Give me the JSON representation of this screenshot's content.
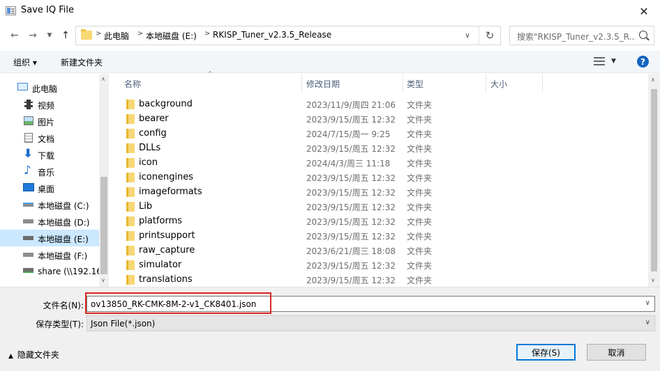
{
  "window": {
    "title": "Save IQ File"
  },
  "address": {
    "crumbs": [
      "此电脑",
      "本地磁盘 (E:)",
      "RKISP_Tuner_v2.3.5_Release"
    ],
    "separator": ">",
    "search_placeholder": "搜索\"RKISP_Tuner_v2.3.5_R..."
  },
  "toolbar": {
    "organize": "组织 ▾",
    "new_folder": "新建文件夹"
  },
  "nav": {
    "items": [
      {
        "label": "此电脑",
        "icon": "computer-icon",
        "selected": false
      },
      {
        "label": "视频",
        "icon": "video-icon",
        "selected": false
      },
      {
        "label": "图片",
        "icon": "pictures-icon",
        "selected": false
      },
      {
        "label": "文档",
        "icon": "documents-icon",
        "selected": false
      },
      {
        "label": "下载",
        "icon": "download-icon",
        "selected": false
      },
      {
        "label": "音乐",
        "icon": "music-icon",
        "selected": false
      },
      {
        "label": "桌面",
        "icon": "desktop-icon",
        "selected": false
      },
      {
        "label": "本地磁盘 (C:)",
        "icon": "drive-icon",
        "selected": false
      },
      {
        "label": "本地磁盘 (D:)",
        "icon": "drive-icon",
        "selected": false
      },
      {
        "label": "本地磁盘 (E:)",
        "icon": "drive-icon",
        "selected": true
      },
      {
        "label": "本地磁盘 (F:)",
        "icon": "drive-icon",
        "selected": false
      },
      {
        "label": "share (\\\\192.16",
        "icon": "network-drive-icon",
        "selected": false
      }
    ]
  },
  "columns": {
    "name": "名称",
    "date": "修改日期",
    "type": "类型",
    "size": "大小"
  },
  "files": [
    {
      "name": "background",
      "date": "2023/11/9/周四 21:06",
      "type": "文件夹"
    },
    {
      "name": "bearer",
      "date": "2023/9/15/周五 12:32",
      "type": "文件夹"
    },
    {
      "name": "config",
      "date": "2024/7/15/周一 9:25",
      "type": "文件夹"
    },
    {
      "name": "DLLs",
      "date": "2023/9/15/周五 12:32",
      "type": "文件夹"
    },
    {
      "name": "icon",
      "date": "2024/4/3/周三 11:18",
      "type": "文件夹"
    },
    {
      "name": "iconengines",
      "date": "2023/9/15/周五 12:32",
      "type": "文件夹"
    },
    {
      "name": "imageformats",
      "date": "2023/9/15/周五 12:32",
      "type": "文件夹"
    },
    {
      "name": "Lib",
      "date": "2023/9/15/周五 12:32",
      "type": "文件夹"
    },
    {
      "name": "platforms",
      "date": "2023/9/15/周五 12:32",
      "type": "文件夹"
    },
    {
      "name": "printsupport",
      "date": "2023/9/15/周五 12:32",
      "type": "文件夹"
    },
    {
      "name": "raw_capture",
      "date": "2023/6/21/周三 18:08",
      "type": "文件夹"
    },
    {
      "name": "simulator",
      "date": "2023/9/15/周五 12:32",
      "type": "文件夹"
    },
    {
      "name": "translations",
      "date": "2023/9/15/周五 12:32",
      "type": "文件夹"
    }
  ],
  "form": {
    "filename_label": "文件名(N):",
    "filename_value": "ov13850_RK-CMK-8M-2-v1_CK8401.json",
    "filetype_label": "保存类型(T):",
    "filetype_value": "Json File(*.json)"
  },
  "footer": {
    "hide_folders": "隐藏文件夹",
    "save": "保存(S)",
    "cancel": "取消"
  },
  "colors": {
    "selection": "#cce8ff",
    "accent": "#0078d7",
    "highlight": "#d9281e",
    "folder": "#f8d775"
  }
}
